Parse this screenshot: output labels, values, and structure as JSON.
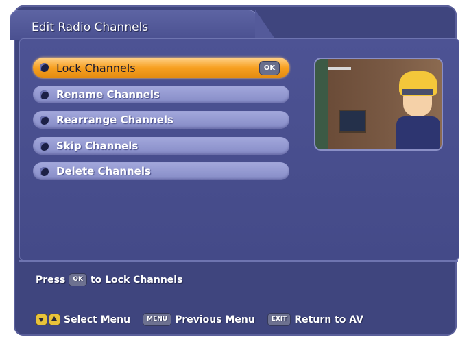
{
  "title": "Edit Radio Channels",
  "menu": {
    "items": [
      {
        "label": "Lock Channels",
        "selected": true
      },
      {
        "label": "Rename Channels",
        "selected": false
      },
      {
        "label": "Rearrange Channels",
        "selected": false
      },
      {
        "label": "Skip Channels",
        "selected": false
      },
      {
        "label": "Delete Channels",
        "selected": false
      }
    ],
    "ok_key": "OK"
  },
  "hint": {
    "prefix": "Press",
    "key": "OK",
    "suffix": "to Lock Channels"
  },
  "footer": {
    "select_label": "Select Menu",
    "menu_key": "MENU",
    "previous_label": "Previous Menu",
    "exit_key": "EXIT",
    "return_label": "Return to AV"
  },
  "colors": {
    "background": "#3f457e",
    "selected_item": "#f7a021",
    "item": "#9a9fd6"
  }
}
